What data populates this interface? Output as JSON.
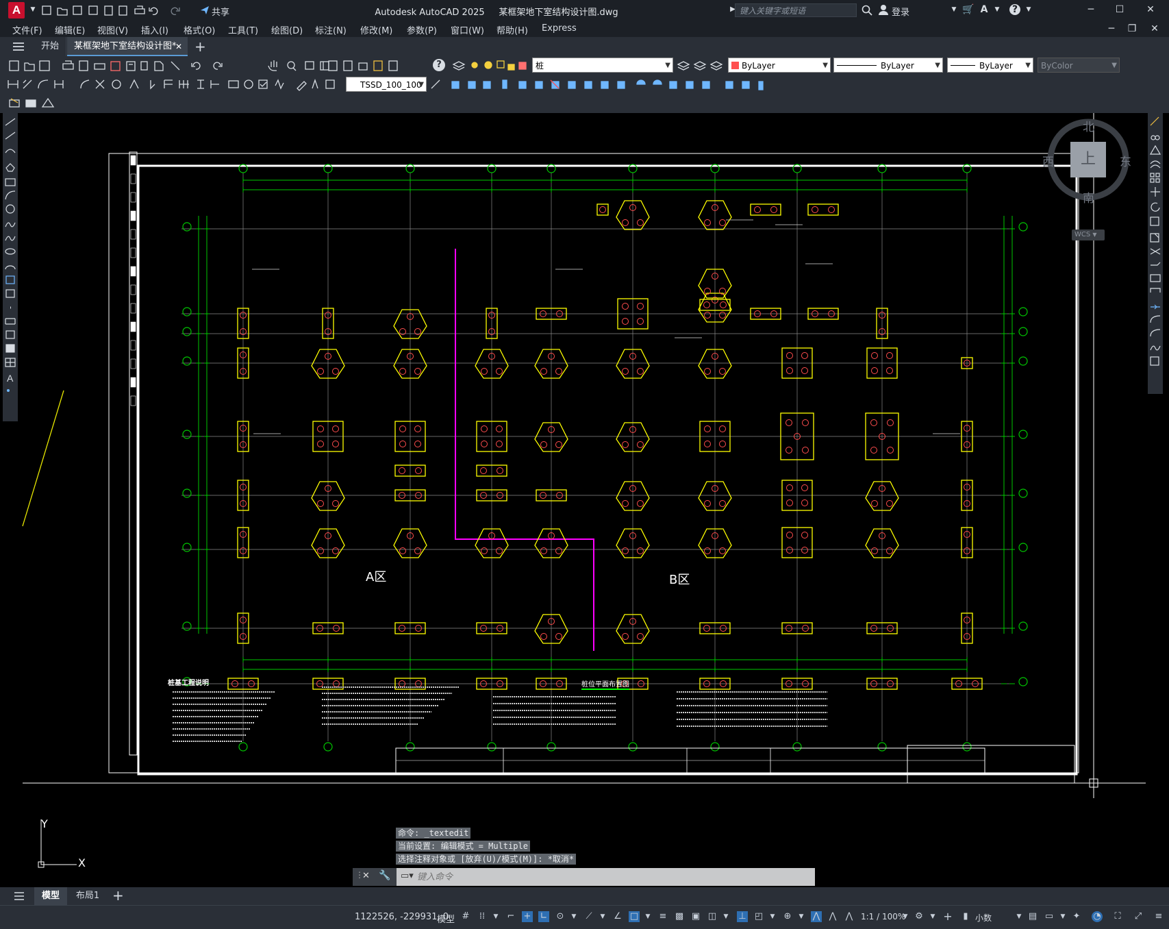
{
  "app": {
    "title": "Autodesk AutoCAD 2025",
    "file_name": "某框架地下室结构设计图.dwg",
    "logo_letter": "A",
    "share_label": "共享",
    "search_placeholder": "键入关键字或短语",
    "login_label": "登录"
  },
  "menu": [
    "文件(F)",
    "编辑(E)",
    "视图(V)",
    "插入(I)",
    "格式(O)",
    "工具(T)",
    "绘图(D)",
    "标注(N)",
    "修改(M)",
    "参数(P)",
    "窗口(W)",
    "帮助(H)",
    "Express"
  ],
  "tabs": {
    "start": "开始",
    "document": "某框架地下室结构设计图*"
  },
  "toolbar": {
    "layer_name": "桩",
    "color": "ByLayer",
    "linetype": "ByLayer",
    "lineweight": "ByLayer",
    "plotstyle": "ByColor",
    "dimstyle": "TSSD_100_100"
  },
  "viewcube": {
    "north": "北",
    "south": "南",
    "east": "东",
    "west": "西",
    "top": "上",
    "wcs": "WCS"
  },
  "drawing": {
    "zone_a": "A区",
    "zone_b": "B区",
    "plan_title": "桩位平面布置图",
    "notes_title": "桩基工程说明",
    "ucs_y": "Y",
    "ucs_x": "X"
  },
  "command": {
    "history": [
      "命令:  _textedit",
      "当前设置: 编辑模式 = Multiple",
      "选择注释对象或 [放弃(U)/模式(M)]: *取消*"
    ],
    "placeholder": "键入命令"
  },
  "layouts": {
    "model": "模型",
    "layout1": "布局1"
  },
  "status": {
    "coordinates": "1122526, -229931, 0",
    "model": "模型",
    "scale": "1:1 / 100%",
    "units": "小数"
  },
  "colors": {
    "axis_line": "#00c800",
    "pile_cap": "#ffff00",
    "pile": "#ff4d4d",
    "zone_divider": "#ff00ff",
    "frame": "#ffffff"
  }
}
